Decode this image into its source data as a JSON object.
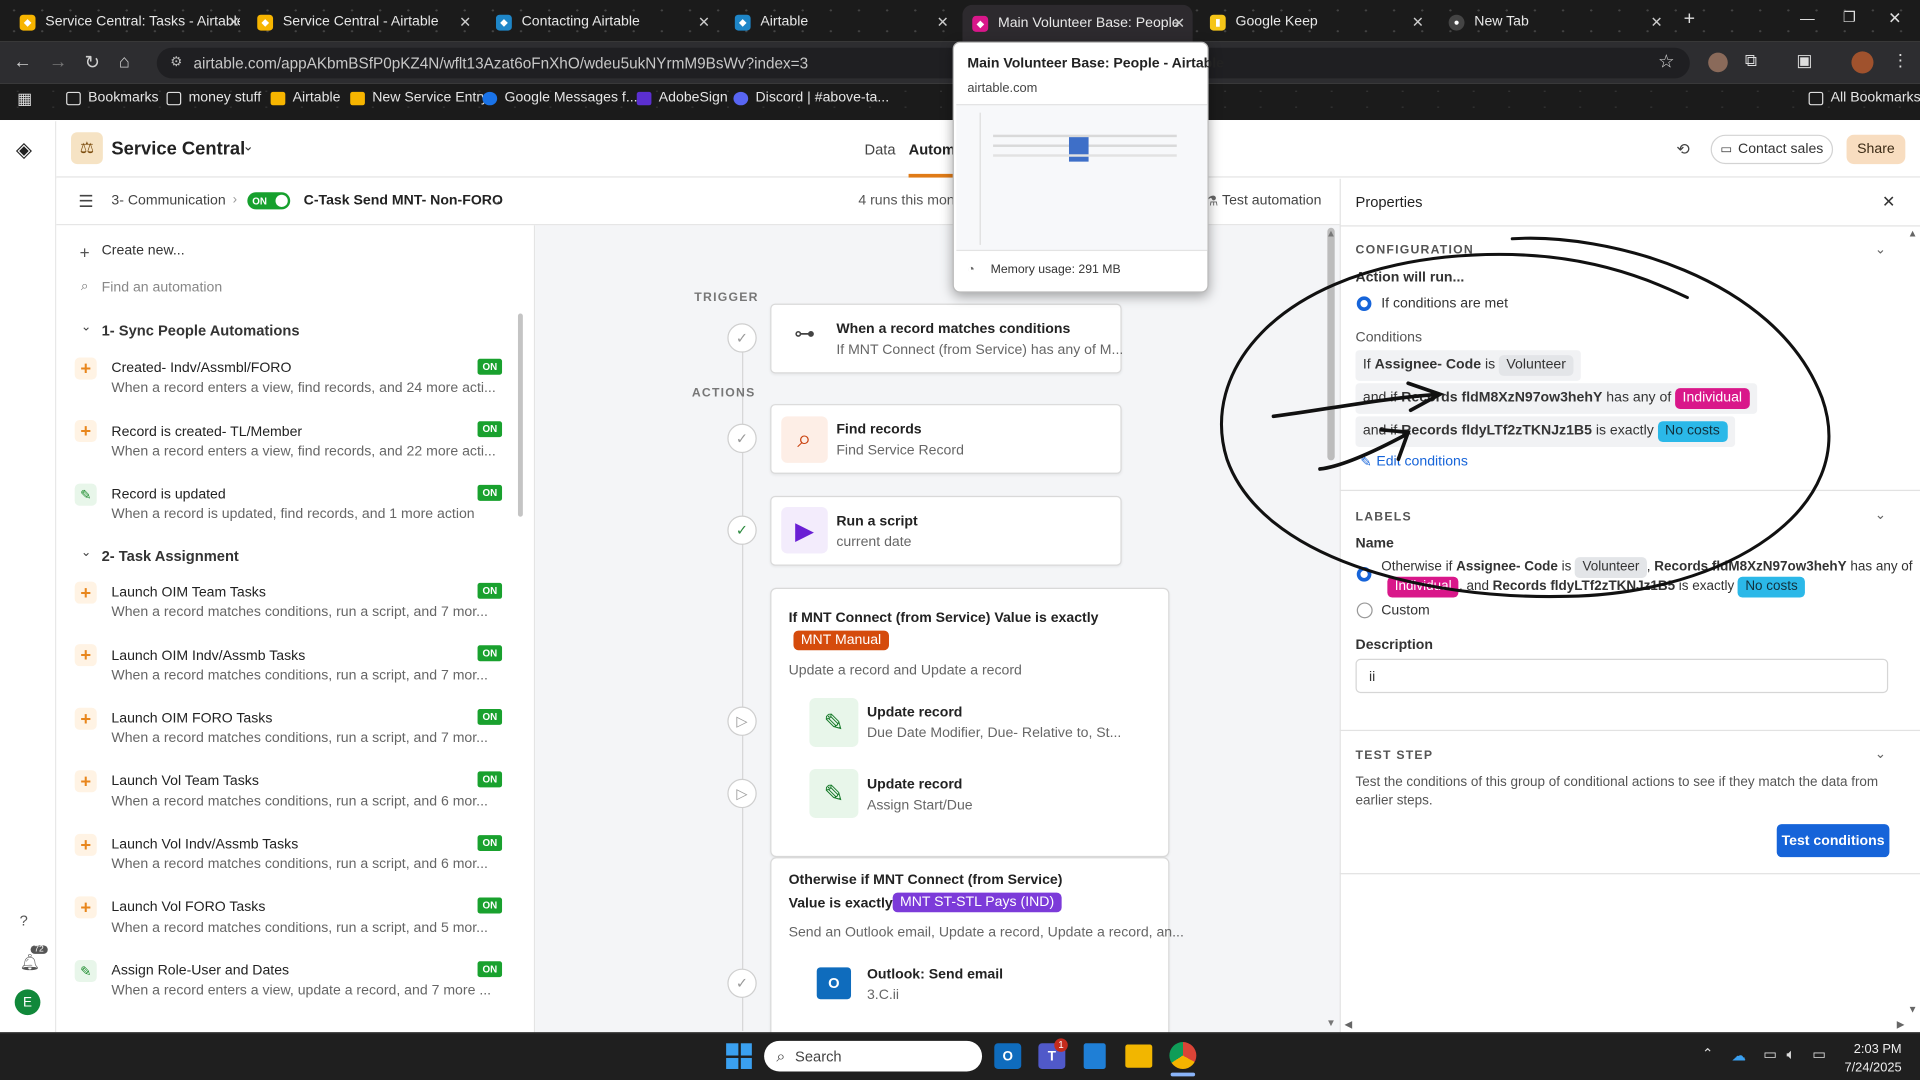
{
  "browser": {
    "tabs": [
      {
        "title": "Service Central: Tasks - Airtable",
        "icon": "airtable-icon"
      },
      {
        "title": "Service Central - Airtable",
        "icon": "airtable-icon"
      },
      {
        "title": "Contacting Airtable",
        "icon": "airtable-icon"
      },
      {
        "title": "Airtable",
        "icon": "airtable-icon"
      },
      {
        "title": "Main Volunteer Base: People",
        "icon": "airtable-icon"
      },
      {
        "title": "Google Keep",
        "icon": "google-keep-icon"
      },
      {
        "title": "New Tab",
        "icon": "chrome-icon"
      }
    ],
    "url": "airtable.com/appAKbmBSfP0pKZ4N/wflt13Azat6oFnXhO/wdeu5ukNYrmM9BsWv?index=3",
    "bookmarks": [
      "Bookmarks",
      "money stuff",
      "Airtable",
      "New Service Entry",
      "Google Messages f...",
      "AdobeSign",
      "Discord | #above-ta..."
    ],
    "all_bookmarks": "All Bookmarks",
    "tooltip": {
      "title": "Main Volunteer Base: People - Airtable",
      "domain": "airtable.com",
      "memory": "Memory usage: 291 MB"
    }
  },
  "app": {
    "base_name": "Service Central",
    "nav_tabs": [
      "Data",
      "Automa"
    ],
    "contact_sales": "Contact sales",
    "share": "Share",
    "breadcrumb_section": "3- Communication",
    "toggle": "ON",
    "automation_name": "C-Task Send MNT- Non-FORO",
    "runs": "4 runs this mont",
    "test_automation": "Test automation",
    "create_new": "Create new...",
    "find_placeholder": "Find an automation",
    "notifications_count": "72",
    "user_initial": "E"
  },
  "sidebar": {
    "sections": [
      {
        "title": "1- Sync People Automations",
        "items": [
          {
            "name": "Created- Indv/Assmbl/FORO",
            "desc": "When a record enters a view, find records, and 24 more acti...",
            "icon": "plus",
            "status": "ON"
          },
          {
            "name": "Record is created- TL/Member",
            "desc": "When a record enters a view, find records, and 22 more acti...",
            "icon": "plus",
            "status": "ON"
          },
          {
            "name": "Record is updated",
            "desc": "When a record is updated, find records, and 1 more action",
            "icon": "pencil",
            "status": "ON"
          }
        ]
      },
      {
        "title": "2- Task Assignment",
        "items": [
          {
            "name": "Launch OIM Team Tasks",
            "desc": "When a record matches conditions, run a script, and 7 mor...",
            "icon": "plus",
            "status": "ON"
          },
          {
            "name": "Launch OIM Indv/Assmb Tasks",
            "desc": "When a record matches conditions, run a script, and 7 mor...",
            "icon": "plus",
            "status": "ON"
          },
          {
            "name": "Launch OIM FORO Tasks",
            "desc": "When a record matches conditions, run a script, and 7 mor...",
            "icon": "plus",
            "status": "ON"
          },
          {
            "name": "Launch Vol Team Tasks",
            "desc": "When a record matches conditions, run a script, and 6 mor...",
            "icon": "plus",
            "status": "ON"
          },
          {
            "name": "Launch Vol Indv/Assmb Tasks",
            "desc": "When a record matches conditions, run a script, and 6 mor...",
            "icon": "plus",
            "status": "ON"
          },
          {
            "name": "Launch Vol FORO Tasks",
            "desc": "When a record matches conditions, run a script, and 5 mor...",
            "icon": "plus",
            "status": "ON"
          },
          {
            "name": "Assign Role-User and Dates",
            "desc": "When a record enters a view, update a record, and 7 more ...",
            "icon": "pencil",
            "status": "ON"
          }
        ]
      }
    ]
  },
  "canvas": {
    "trigger_label": "TRIGGER",
    "actions_label": "ACTIONS",
    "trigger": {
      "title": "When a record matches conditions",
      "desc": "If MNT Connect (from Service) has any of M..."
    },
    "find": {
      "title": "Find records",
      "desc": "Find Service Record"
    },
    "script": {
      "title": "Run a script",
      "desc": "current date"
    },
    "group1": {
      "title": "If MNT Connect (from Service) Value is exactly",
      "chip": "MNT Manual",
      "chip_color": "#d54b0c",
      "desc": "Update a record and Update a record",
      "steps": [
        {
          "title": "Update record",
          "desc": "Due Date Modifier, Due- Relative to, St..."
        },
        {
          "title": "Update record",
          "desc": "Assign Start/Due"
        }
      ]
    },
    "group2": {
      "title": "Otherwise if MNT Connect (from Service)",
      "title2": "Value is exactly",
      "chip": "MNT ST-STL Pays (IND)",
      "chip_color": "#7c3bd9",
      "desc": "Send an Outlook email, Update a record, Update a record, an...",
      "steps": [
        {
          "title": "Outlook: Send email",
          "desc": "3.C.ii"
        }
      ]
    }
  },
  "properties": {
    "title": "Properties",
    "configuration": "CONFIGURATION",
    "action_will_run": "Action will run...",
    "radio_label": "If conditions are met",
    "conditions_label": "Conditions",
    "conditions": [
      {
        "prefix": "If",
        "field": "Assignee- Code",
        "op": "is",
        "value": "Volunteer",
        "chip_bg": "#e9ebee",
        "chip_fg": "#333"
      },
      {
        "prefix": "and if",
        "field": "Records fldM8XzN97ow3hehY",
        "op": "has any of",
        "value": "Individual",
        "chip_bg": "#d9178a",
        "chip_fg": "#fff"
      },
      {
        "prefix": "and if",
        "field": "Records fldyLTf2zTKNJz1B5",
        "op": "is exactly",
        "value": "No costs",
        "chip_bg": "#2bb8e8",
        "chip_fg": "#12313d"
      }
    ],
    "edit_conditions": "Edit conditions",
    "labels": "LABELS",
    "name_label": "Name",
    "name_line1_a": "Otherwise if",
    "name_line1_b": "Assignee- Code",
    "name_line1_c": "is",
    "name_line1_chip": "Volunteer",
    "name_line1_d": "Records fldM8XzN97ow3hehY",
    "name_line1_e": "has any of",
    "name_line2_chip1": "Individual",
    "name_line2_a": ", and",
    "name_line2_b": "Records fldyLTf2zTKNJz1B5",
    "name_line2_c": "is exactly",
    "name_line2_chip2": "No costs",
    "custom": "Custom",
    "description_label": "Description",
    "description_value": "ii",
    "test_step": "TEST STEP",
    "test_desc": "Test the conditions of this group of conditional actions to see if they match the data from earlier steps.",
    "test_button": "Test conditions"
  },
  "taskbar": {
    "search": "Search",
    "time": "2:03 PM",
    "date": "7/24/2025",
    "teams_badge": "1"
  }
}
